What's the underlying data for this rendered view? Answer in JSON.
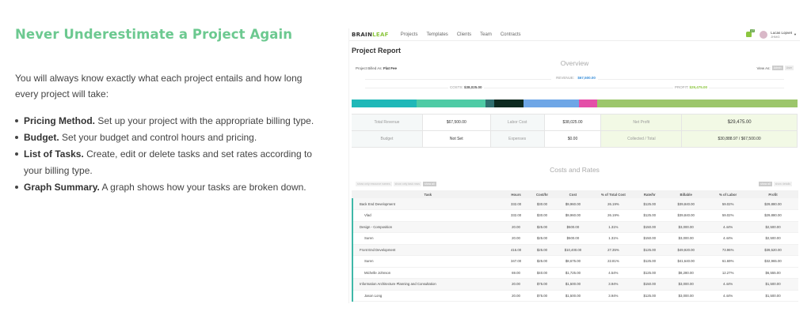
{
  "heading": "Never Underestimate a Project Again",
  "intro": "You will always know exactly what each project entails and how long every project will take:",
  "features": [
    {
      "title": "Pricing Method.",
      "text": "Set up your project with the appropriate billing type."
    },
    {
      "title": "Budget.",
      "text": "Set your budget and control hours and pricing."
    },
    {
      "title": "List of Tasks.",
      "text": "Create, edit or delete tasks and set rates according to your billing type."
    },
    {
      "title": "Graph Summary.",
      "text": "A graph shows how your tasks are broken down."
    }
  ],
  "app": {
    "logo_a": "BRAIN",
    "logo_b": "LEAF",
    "nav": [
      "Projects",
      "Templates",
      "Clients",
      "Team",
      "Contracts"
    ],
    "notification_count": "17",
    "user_name": "Lucas Lopvet",
    "user_company": "JHMG",
    "page_title": "Project Report",
    "billed_label": "Project Billed As:",
    "billed_value": "Flat Fee",
    "overview_title": "Overview",
    "view_as_label": "View As:",
    "view_as_options": [
      "Admin",
      "User"
    ],
    "revenue_label": "REVENUE:",
    "revenue_value": "$67,500.00",
    "costs_label": "COSTS:",
    "costs_value": "$38,025.00",
    "profit_label": "PROFIT:",
    "profit_value": "$29,475.00",
    "stats": {
      "total_revenue_label": "Total Revenue",
      "total_revenue_value": "$67,500.00",
      "labor_cost_label": "Labor Cost",
      "labor_cost_value": "$38,025.00",
      "net_profit_label": "Net Profit",
      "net_profit_value": "$29,475.00",
      "budget_label": "Budget",
      "budget_value": "Not Set",
      "expenses_label": "Expenses",
      "expenses_value": "$0.00",
      "collected_label": "Collected / Total",
      "collected_value": "$30,888.97 / $67,500.00"
    },
    "costs_rates_title": "Costs and Rates",
    "filters_left": [
      "show only resource names",
      "show only task rows",
      "show all"
    ],
    "filters_right": [
      "show all",
      "show details"
    ],
    "table_headers": [
      "Task",
      "Hours",
      "Cost/hr",
      "Cost",
      "% of Total Cost",
      "Rate/hr",
      "Billable",
      "% of Labor",
      "Profit"
    ],
    "rows": [
      {
        "type": "grp",
        "cells": [
          "Back End Development",
          "332.00",
          "$30.00",
          "$9,960.00",
          "26.19%",
          "$125.00",
          "$39,840.00",
          "59.02%",
          "$29,880.00"
        ]
      },
      {
        "type": "sub",
        "cells": [
          "Vlad",
          "332.00",
          "$30.00",
          "$9,960.00",
          "26.19%",
          "$125.00",
          "$39,840.00",
          "59.02%",
          "$29,880.00"
        ]
      },
      {
        "type": "grp",
        "cells": [
          "Design - Composition",
          "20.00",
          "$25.00",
          "$500.00",
          "1.31%",
          "$150.00",
          "$3,000.00",
          "4.44%",
          "$2,500.00"
        ]
      },
      {
        "type": "sub",
        "cells": [
          "Suren",
          "20.00",
          "$25.00",
          "$500.00",
          "1.31%",
          "$150.00",
          "$3,000.00",
          "4.44%",
          "$2,500.00"
        ]
      },
      {
        "type": "grp",
        "cells": [
          "Front End Development",
          "416.00",
          "$25.00",
          "$10,400.00",
          "27.35%",
          "$125.00",
          "$49,920.00",
          "73.96%",
          "$39,520.00"
        ]
      },
      {
        "type": "sub",
        "cells": [
          "Suren",
          "347.00",
          "$25.00",
          "$8,675.00",
          "22.81%",
          "$125.00",
          "$41,640.00",
          "61.69%",
          "$32,965.00"
        ]
      },
      {
        "type": "sub",
        "cells": [
          "Michelle Johnson",
          "69.00",
          "$40.00",
          "$1,725.00",
          "4.54%",
          "$125.00",
          "$8,280.00",
          "12.27%",
          "$6,555.00"
        ]
      },
      {
        "type": "grp",
        "cells": [
          "Information Architecture Planning and Consultation",
          "20.00",
          "$75.00",
          "$1,500.00",
          "3.94%",
          "$150.00",
          "$3,000.00",
          "4.44%",
          "$1,500.00"
        ]
      },
      {
        "type": "sub",
        "cells": [
          "Jason Long",
          "20.00",
          "$75.00",
          "$1,500.00",
          "3.94%",
          "$125.00",
          "$3,000.00",
          "4.44%",
          "$1,500.00"
        ]
      }
    ],
    "bar_segments": [
      {
        "color": "#1fb8b8",
        "share": 0.145
      },
      {
        "color": "#4ecba5",
        "share": 0.155
      },
      {
        "color": "#2f6f6f",
        "share": 0.02
      },
      {
        "color": "#0d2a20",
        "share": 0.065
      },
      {
        "color": "#6ea6e6",
        "share": 0.125
      },
      {
        "color": "#e44fa8",
        "share": 0.04
      },
      {
        "color": "#9cc66b",
        "share": 0.45
      }
    ]
  }
}
